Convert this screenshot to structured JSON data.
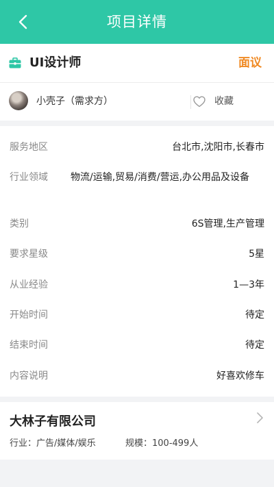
{
  "header": {
    "title": "项目详情"
  },
  "project": {
    "title": "UI设计师",
    "price": "面议"
  },
  "owner": {
    "name": "小壳子（需求方）",
    "favorite_label": "收藏"
  },
  "details": [
    {
      "label": "服务地区",
      "value": "台北市,沈阳市,长春市"
    },
    {
      "label": "行业领域",
      "value": "物流/运输,贸易/消费/营运,办公用品及设备"
    },
    {
      "label": "类别",
      "value": "6S管理,生产管理"
    },
    {
      "label": "要求星级",
      "value": "5星"
    },
    {
      "label": "从业经验",
      "value": "1—3年"
    },
    {
      "label": "开始时间",
      "value": "待定"
    },
    {
      "label": "结束时间",
      "value": "待定"
    },
    {
      "label": "内容说明",
      "value": "好喜欢修车"
    }
  ],
  "company": {
    "name": "大林子有限公司",
    "industry_label": "行业：",
    "industry": "广告/媒体/娱乐",
    "scale_label": "规模：",
    "scale": "100-499人"
  },
  "colors": {
    "primary": "#2ec7a6",
    "accent": "#f08a24",
    "background": "#f2f3f5"
  },
  "icons": {
    "back": "chevron-left-icon",
    "briefcase": "briefcase-icon",
    "favorite": "heart-outline-icon",
    "arrow": "chevron-right-icon"
  }
}
